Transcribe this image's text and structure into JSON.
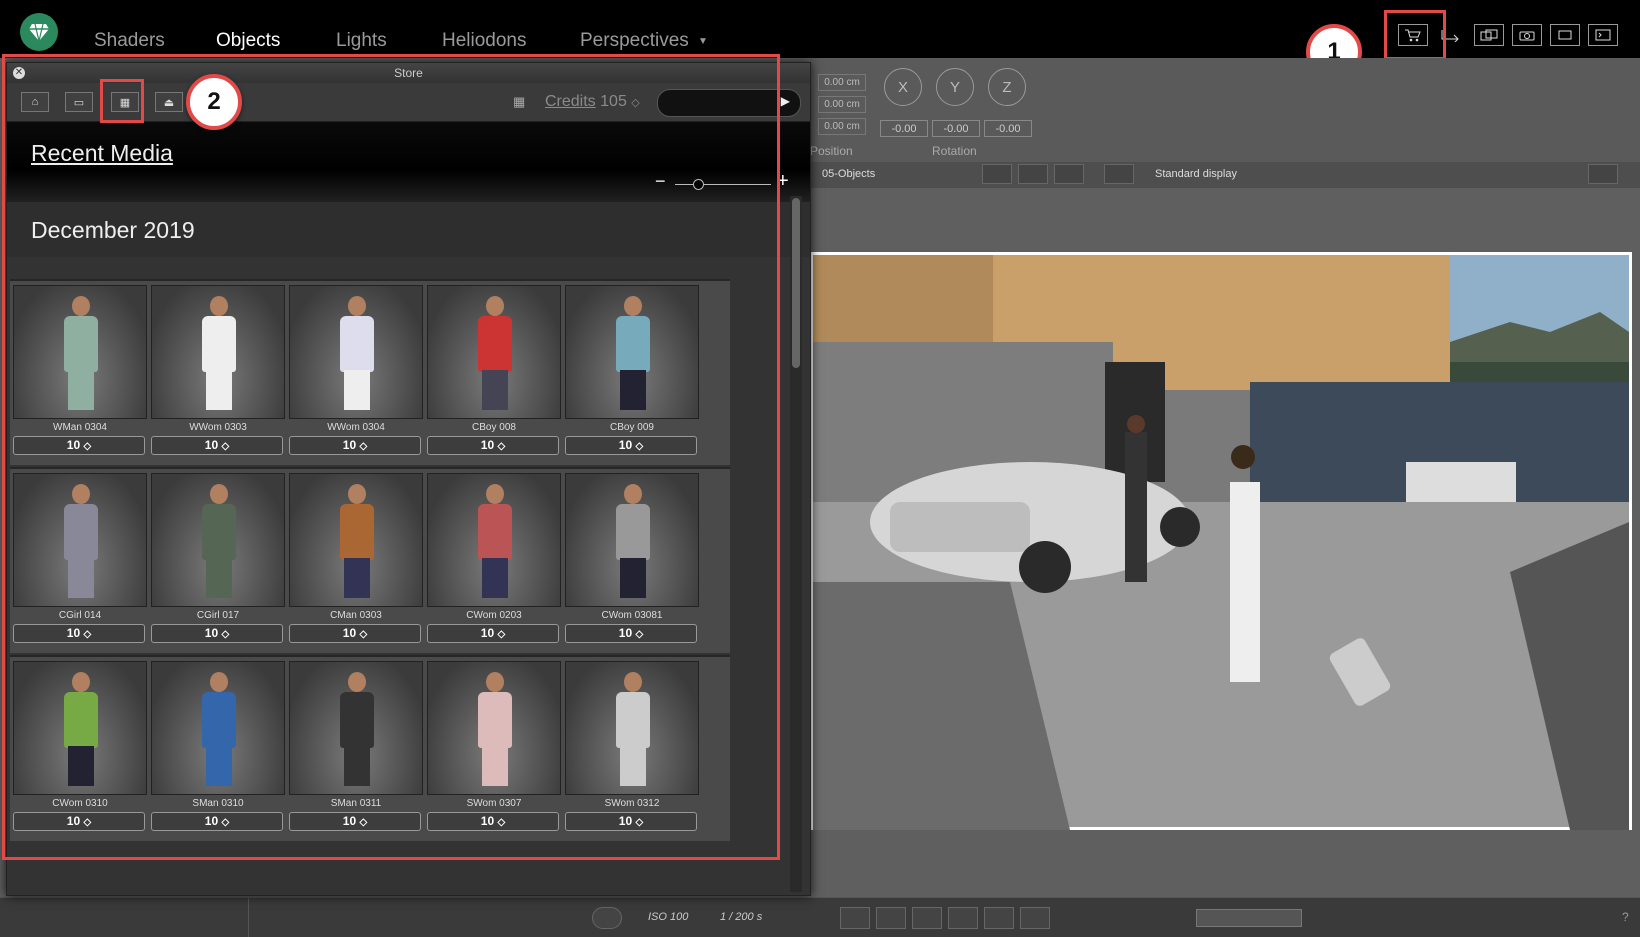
{
  "nav": {
    "tabs": [
      "Shaders",
      "Objects",
      "Lights",
      "Heliodons",
      "Perspectives"
    ],
    "active": "Objects"
  },
  "callouts": {
    "one": "1",
    "two": "2"
  },
  "properties": {
    "positions": [
      "0.00 cm",
      "0.00 cm",
      "0.00 cm"
    ],
    "position_label": "Position",
    "rotation_label": "Rotation",
    "axes": [
      "X",
      "Y",
      "Z"
    ],
    "rotations": [
      "-0.00",
      "-0.00",
      "-0.00"
    ]
  },
  "viewport_toolbar": {
    "layer": "05-Objects",
    "display_mode": "Standard display"
  },
  "store": {
    "title": "Store",
    "credits_label": "Credits",
    "credits_value": "105",
    "section_title": "Recent Media",
    "month": "December 2019",
    "items": [
      {
        "name": "WMan 0304",
        "price": "10"
      },
      {
        "name": "WWom 0303",
        "price": "10"
      },
      {
        "name": "WWom 0304",
        "price": "10"
      },
      {
        "name": "CBoy 008",
        "price": "10"
      },
      {
        "name": "CBoy 009",
        "price": "10"
      },
      {
        "name": "CGirl 014",
        "price": "10"
      },
      {
        "name": "CGirl 017",
        "price": "10"
      },
      {
        "name": "CMan 0303",
        "price": "10"
      },
      {
        "name": "CWom 0203",
        "price": "10"
      },
      {
        "name": "CWom 03081",
        "price": "10"
      },
      {
        "name": "CWom 0310",
        "price": "10"
      },
      {
        "name": "SMan 0310",
        "price": "10"
      },
      {
        "name": "SMan 0311",
        "price": "10"
      },
      {
        "name": "SWom 0307",
        "price": "10"
      },
      {
        "name": "SWom 0312",
        "price": "10"
      }
    ]
  },
  "statusbar": {
    "iso": "ISO 100",
    "shutter": "1 / 200 s",
    "help": "?"
  }
}
